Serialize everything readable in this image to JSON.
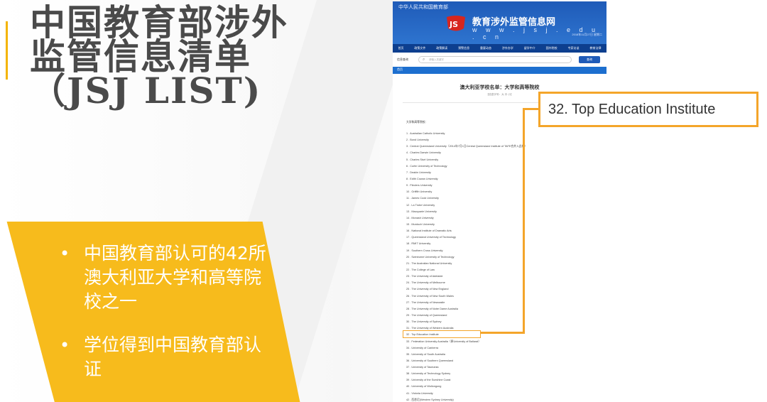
{
  "slide": {
    "title_lines": [
      "中国教育部涉外",
      "监管信息清单",
      "（JSJ LIST)"
    ],
    "bullets": [
      "中国教育部认可的42所澳大利亚大学和高等院校之一",
      "学位得到中国教育部认证"
    ],
    "accent_color": "#f7bb1c"
  },
  "website": {
    "top_line": "中华人民共和国教育部",
    "site_name": "教育涉外监管信息网",
    "domain": "w w w . j s j . e d u . c n",
    "date_text": "2018年11月27日 星期二",
    "nav": [
      "首页",
      "政策文件",
      "政策解读",
      "预警信息",
      "重要动态",
      "涉外办学",
      "留学中介",
      "国外院校",
      "专家访谈",
      "教育法律"
    ],
    "search_label": "信息查询",
    "search_placeholder": "请输入关键字",
    "search_button": "查询",
    "breadcrumb": "首页",
    "article_title": "澳大利亚学校名单：大学和高等院校",
    "article_meta": "【信息字号：大 中 小】",
    "list_heading": "大学和高等院校：",
    "universities": [
      "1 . Australian Catholic University",
      "2 . Bond University",
      "3 . Central Queensland University（2014年7月1日Central Queensland Institute of TAFE合并入此校）",
      "4 . Charles Darwin University",
      "5 . Charles Sturt University",
      "6 . Curtin University of Technology",
      "7 . Deakin University",
      "8 . Edith Cowan University",
      "9 . Flinders University",
      "10 . Griffith University",
      "11 . James Cook University",
      "12 . La Trobe University",
      "13 . Macquarie University",
      "14 . Monash University",
      "15 . Murdoch University",
      "16 . National Institute of Dramatic Arts",
      "17 . Queensland University of Technology",
      "18 . RMIT University",
      "19 . Southern Cross University",
      "20 . Swinburne University of Technology",
      "21 . The Australian National University",
      "22 . The College of Law",
      "23 . The University of Adelaide",
      "24 . The University of Melbourne",
      "25 . The University of New England",
      "26 . The University of New South Wales",
      "27 . The University of Newcastle",
      "28 . The University of Notre Dame Australia",
      "29 . The University of Queensland",
      "30 . The University of Sydney",
      "31 . The University of Western Australia",
      "32 . Top Education Institute",
      "33 . Federation University Australia（原University of Ballarat）",
      "34 . University of Canberra",
      "35 . University of South Australia",
      "36 . University of Southern Queensland",
      "37 . University of Tasmania",
      "38 . University of Technology Sydney",
      "39 . University of the Sunshine Coast",
      "40 . University of Wollongong",
      "41 . Victoria University",
      "42 . 西悉尼(Western Sydney University)"
    ]
  },
  "callout": {
    "text": "32. Top Education Institute",
    "color": "#f4a52a"
  }
}
